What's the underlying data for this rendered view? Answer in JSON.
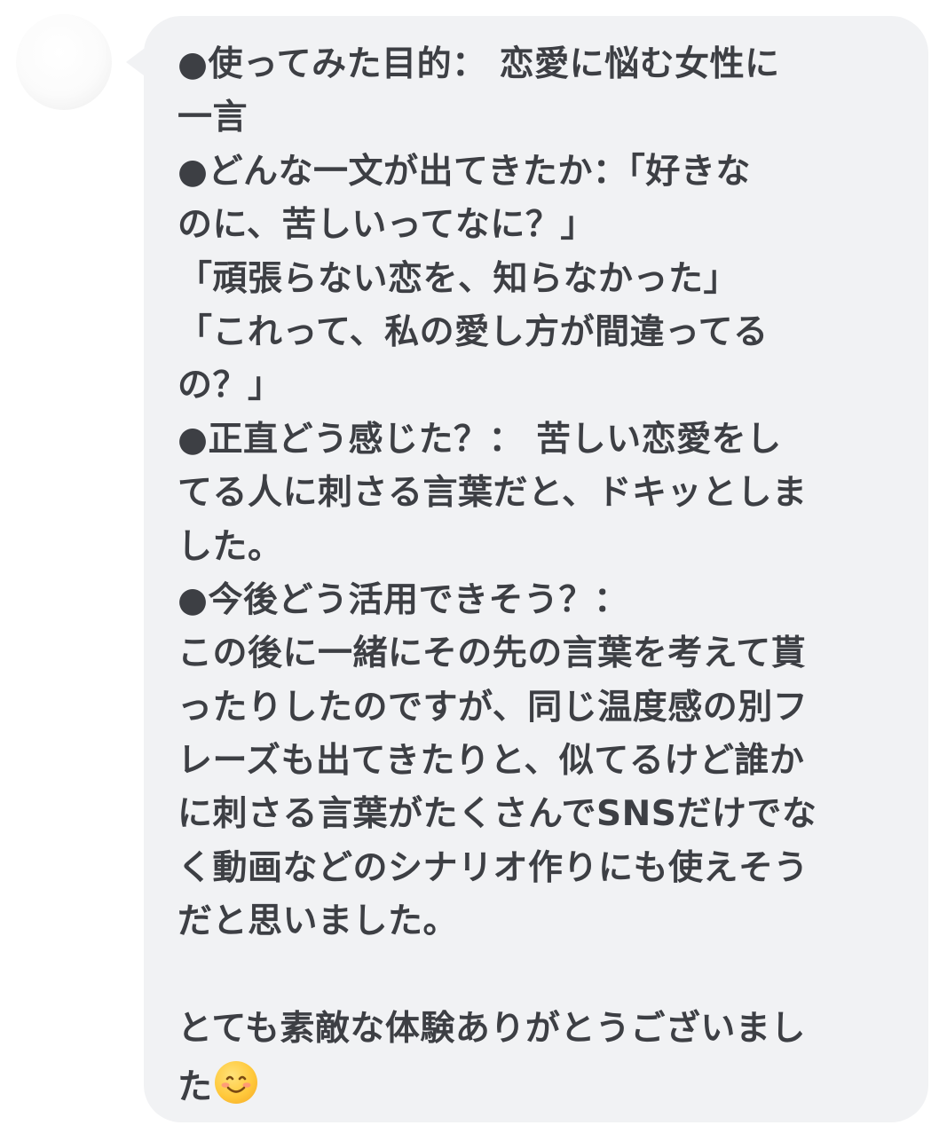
{
  "avatar": {
    "icon": "user-avatar"
  },
  "message": {
    "lines": [
      "●使ってみた目的： 恋愛に悩む女性に",
      "一言",
      "●どんな一文が出てきたか：「好きな",
      "のに、苦しいってなに？」",
      "「頑張らない恋を、知らなかった」",
      "「これって、私の愛し方が間違ってる",
      "の？」",
      "●正直どう感じた？： 苦しい恋愛をし",
      "てる人に刺さる言葉だと、ドキッとしま",
      "した。",
      "●今後どう活用できそう？：",
      "この後に一緒にその先の言葉を考えて貰",
      "ったりしたのですが、同じ温度感の別フ",
      "レーズも出てきたりと、似てるけど誰か",
      "に刺さる言葉がたくさんでSNSだけでな",
      "く動画などのシナリオ作りにも使えそう",
      "だと思いました。",
      "",
      "とても素敵な体験ありがとうございまし",
      "た"
    ],
    "emoji": "smiling-face-emoji"
  },
  "colors": {
    "bubble": "#f1f2f4",
    "text": "#3d3f44",
    "background": "#ffffff"
  }
}
